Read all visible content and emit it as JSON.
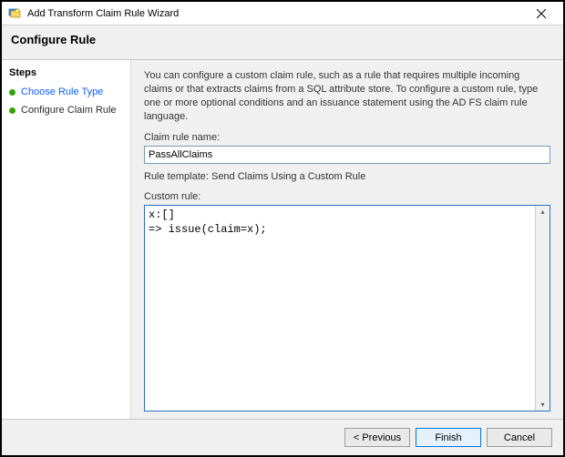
{
  "window": {
    "title": "Add Transform Claim Rule Wizard"
  },
  "header": {
    "title": "Configure Rule"
  },
  "sidebar": {
    "heading": "Steps",
    "items": [
      {
        "label": "Choose Rule Type"
      },
      {
        "label": "Configure Claim Rule"
      }
    ]
  },
  "main": {
    "description": "You can configure a custom claim rule, such as a rule that requires multiple incoming claims or that extracts claims from a SQL attribute store. To configure a custom rule, type one or more optional conditions and an issuance statement using the AD FS claim rule language.",
    "claim_rule_name_label": "Claim rule name:",
    "claim_rule_name_value": "PassAllClaims",
    "rule_template_label": "Rule template: Send Claims Using a Custom Rule",
    "custom_rule_label": "Custom rule:",
    "custom_rule_value": "x:[]\n=> issue(claim=x);"
  },
  "footer": {
    "previous": "< Previous",
    "finish": "Finish",
    "cancel": "Cancel"
  }
}
